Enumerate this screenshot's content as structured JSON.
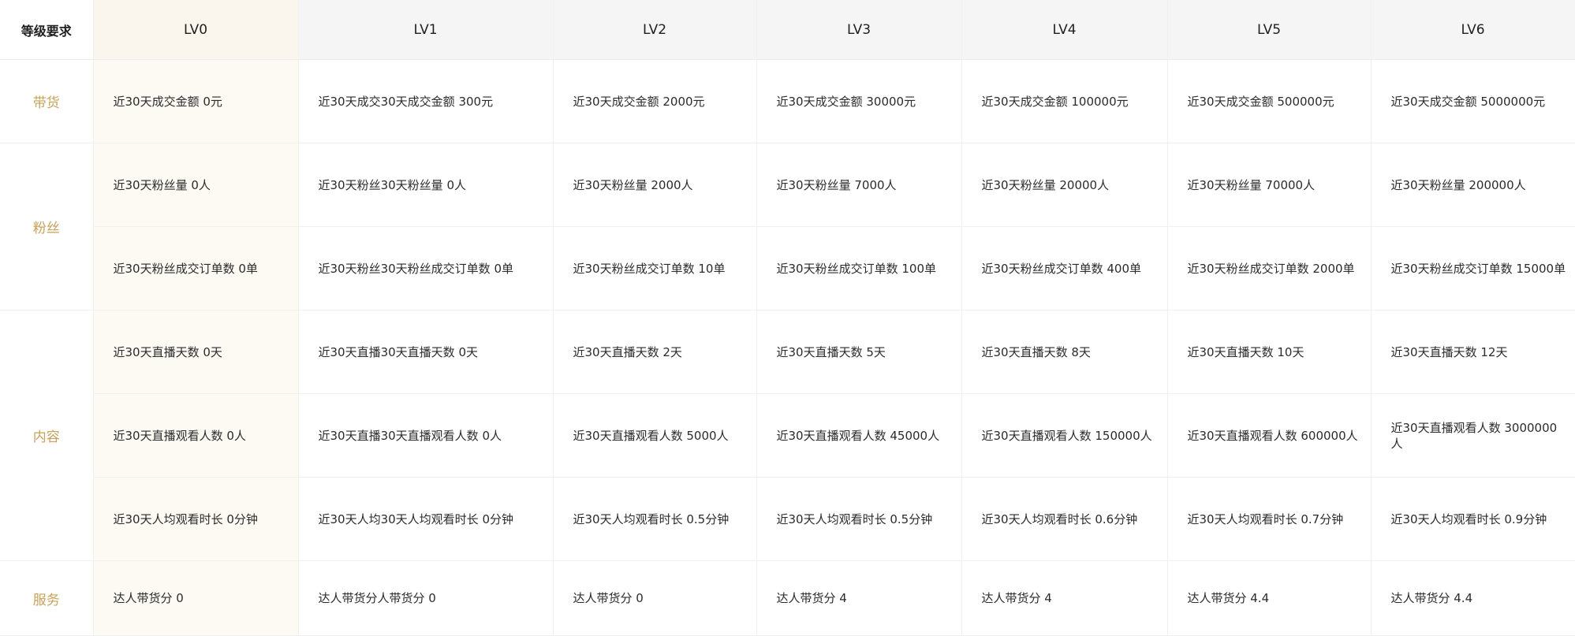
{
  "header": {
    "corner": "等级要求",
    "levels": [
      "LV0",
      "LV1",
      "LV2",
      "LV3",
      "LV4",
      "LV5",
      "LV6"
    ]
  },
  "categories": {
    "daihuo": "带货",
    "fensi": "粉丝",
    "neirong": "内容",
    "fuwu": "服务"
  },
  "rows": [
    {
      "cells": [
        "近30天成交金额 0元",
        "近30天成交30天成交金额 300元",
        "近30天成交金额 2000元",
        "近30天成交金额 30000元",
        "近30天成交金额 100000元",
        "近30天成交金额 500000元",
        "近30天成交金额 5000000元"
      ]
    },
    {
      "cells": [
        "近30天粉丝量 0人",
        "近30天粉丝30天粉丝量 0人",
        "近30天粉丝量 2000人",
        "近30天粉丝量 7000人",
        "近30天粉丝量 20000人",
        "近30天粉丝量 70000人",
        "近30天粉丝量 200000人"
      ]
    },
    {
      "cells": [
        "近30天粉丝成交订单数 0单",
        "近30天粉丝30天粉丝成交订单数 0单",
        "近30天粉丝成交订单数 10单",
        "近30天粉丝成交订单数 100单",
        "近30天粉丝成交订单数 400单",
        "近30天粉丝成交订单数 2000单",
        "近30天粉丝成交订单数 15000单"
      ]
    },
    {
      "cells": [
        "近30天直播天数 0天",
        "近30天直播30天直播天数 0天",
        "近30天直播天数 2天",
        "近30天直播天数 5天",
        "近30天直播天数 8天",
        "近30天直播天数 10天",
        "近30天直播天数 12天"
      ]
    },
    {
      "cells": [
        "近30天直播观看人数 0人",
        "近30天直播30天直播观看人数 0人",
        "近30天直播观看人数 5000人",
        "近30天直播观看人数 45000人",
        "近30天直播观看人数 150000人",
        "近30天直播观看人数 600000人",
        "近30天直播观看人数 3000000人"
      ]
    },
    {
      "cells": [
        "近30天人均观看时长 0分钟",
        "近30天人均30天人均观看时长 0分钟",
        "近30天人均观看时长 0.5分钟",
        "近30天人均观看时长 0.5分钟",
        "近30天人均观看时长 0.6分钟",
        "近30天人均观看时长 0.7分钟",
        "近30天人均观看时长 0.9分钟"
      ]
    },
    {
      "cells": [
        "达人带货分 0",
        "达人带货分人带货分 0",
        "达人带货分 0",
        "达人带货分 4",
        "达人带货分 4",
        "达人带货分 4.4",
        "达人带货分 4.4"
      ]
    }
  ],
  "colors": {
    "category_text": "#c7a259",
    "lv0_column_bg": "#fdfaf4",
    "header_bg": "#f5f5f5",
    "border": "#f0f0f0"
  }
}
